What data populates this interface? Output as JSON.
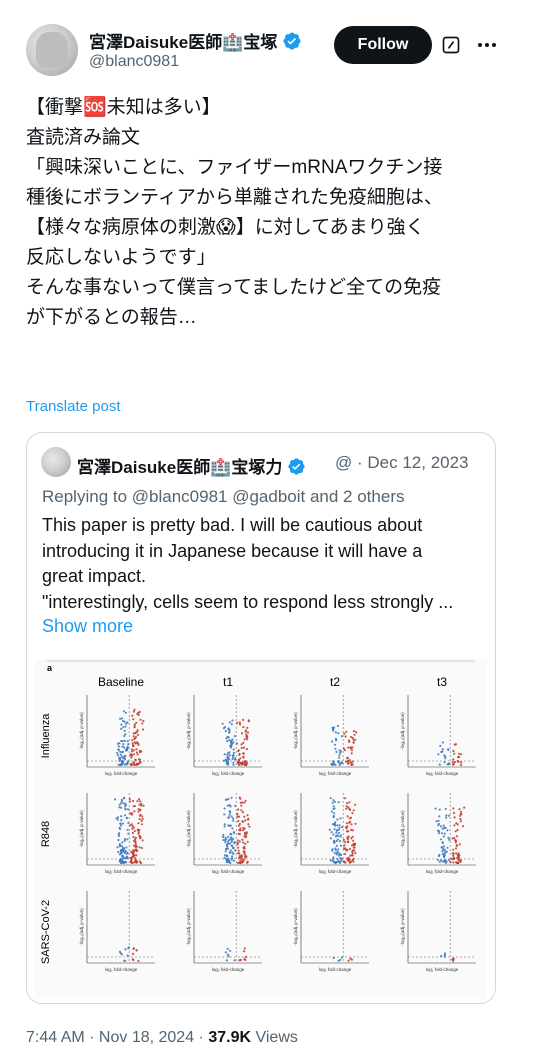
{
  "author": {
    "name": "宮澤Daisuke医師🏥宝塚",
    "handle": "@blanc0981",
    "verified": true,
    "avatar": "avatar"
  },
  "actions": {
    "follow_label": "Follow",
    "grok_icon": "grok-icon",
    "more_icon": "more-icon"
  },
  "post": {
    "lines": [
      "【衝撃🆘未知は多い】",
      "査読済み論文",
      "",
      "「興味深いことに、ファイザーmRNAワクチン接",
      "種後にボランティアから単離された免疫細胞は、",
      "【様々な病原体の刺激😱】に対してあまり強く",
      "反応しないようです」",
      "",
      "そんな事ないって僕言ってましたけど全ての免疫",
      "が下がるとの報告…"
    ],
    "translate_label": "Translate post"
  },
  "quote": {
    "name": "宮澤Daisuke医師🏥宝塚力",
    "handle": "@",
    "date": "· Dec 12, 2023",
    "reply_line": "Replying to @blanc0981 @gadboit and 2 others",
    "text_lines": [
      "This paper is pretty bad. I will be cautious about",
      "introducing it in Japanese because it will have a",
      "great impact.",
      "\"interestingly, cells seem to respond less strongly ..."
    ],
    "show_more": "Show more",
    "figure": {
      "panel_label": "a",
      "columns": [
        "Baseline",
        "t1",
        "t2",
        "t3"
      ],
      "rows": [
        "Influenza",
        "R848",
        "SARS-CoV-2"
      ],
      "x_axis_label": "log₂ fold-change",
      "y_axis_label": "-log₁₀(adj. p-value)",
      "colors": {
        "down": "#3a78c0",
        "up": "#c0392b"
      }
    }
  },
  "footer": {
    "time": "7:44 AM",
    "sep1": " · ",
    "date": "Nov 18, 2024",
    "sep2": " · ",
    "views_count": "37.9K",
    "views_label": " Views"
  }
}
